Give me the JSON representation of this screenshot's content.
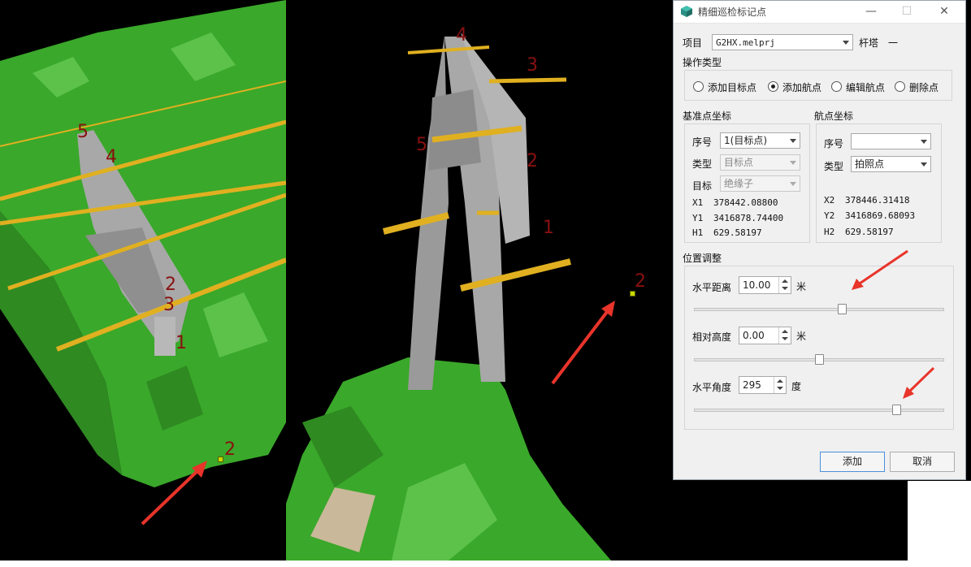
{
  "window": {
    "title": "精细巡检标记点",
    "min": "—",
    "max": "☐",
    "close": "✕"
  },
  "project": {
    "label": "项目",
    "value": "G2HX.melprj",
    "tower_label": "杆塔",
    "tower_value": "一"
  },
  "operation": {
    "label": "操作类型",
    "options": [
      "添加目标点",
      "添加航点",
      "编辑航点",
      "删除点"
    ],
    "selected": "添加航点"
  },
  "base": {
    "group_label": "基准点坐标",
    "seq_label": "序号",
    "seq_value": "1(目标点)",
    "type_label": "类型",
    "type_value": "目标点",
    "target_label": "目标",
    "target_value": "绝缘子",
    "x_label": "X1",
    "x_value": "378442.08800",
    "y_label": "Y1",
    "y_value": "3416878.74400",
    "h_label": "H1",
    "h_value": "629.58197"
  },
  "waypoint": {
    "group_label": "航点坐标",
    "seq_label": "序号",
    "seq_value": "",
    "type_label": "类型",
    "type_value": "拍照点",
    "x_label": "X2",
    "x_value": "378446.31418",
    "y_label": "Y2",
    "y_value": "3416869.68093",
    "h_label": "H2",
    "h_value": "629.58197"
  },
  "adjust": {
    "group_label": "位置调整",
    "distance": {
      "label": "水平距离",
      "value": "10.00",
      "unit": "米",
      "slider_fraction": 0.59
    },
    "height": {
      "label": "相对高度",
      "value": "0.00",
      "unit": "米",
      "slider_fraction": 0.5
    },
    "angle": {
      "label": "水平角度",
      "value": "295",
      "unit": "度",
      "slider_fraction": 0.81
    }
  },
  "buttons": {
    "add": "添加",
    "cancel": "取消"
  },
  "scene": {
    "left_markers": [
      "5",
      "4",
      "2",
      "3",
      "1",
      "2"
    ],
    "right_markers": [
      "4",
      "3",
      "5",
      "2",
      "1",
      "2"
    ]
  },
  "colors": {
    "vegetation": "#3aa82a",
    "tower": "#a8a8a8",
    "insulator": "#e0b020",
    "marker": "#8a1010",
    "arrow": "#e8342a"
  }
}
